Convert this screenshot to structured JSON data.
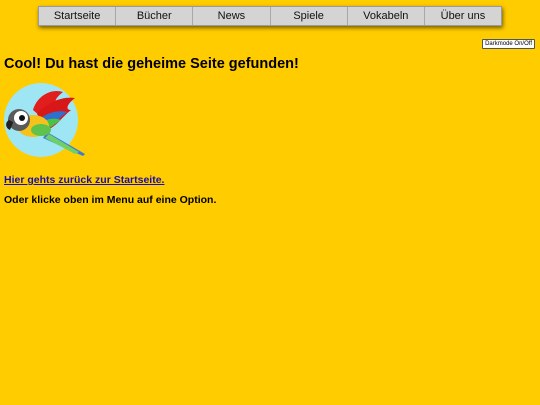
{
  "nav": {
    "items": [
      {
        "label": "Startseite"
      },
      {
        "label": "Bücher"
      },
      {
        "label": "News"
      },
      {
        "label": "Spiele"
      },
      {
        "label": "Vokabeln"
      },
      {
        "label": "Über uns"
      }
    ]
  },
  "darkmode_button": {
    "label": "Darkmode On/Off"
  },
  "main": {
    "headline": "Cool! Du hast die geheime Seite gefunden!",
    "back_link": "Hier gehts zurück zur Startseite.",
    "hint": "Oder klicke oben im Menu auf eine Option."
  },
  "colors": {
    "background": "#ffcc00",
    "nav_background": "#d4d4d4",
    "link": "#1a0dab",
    "parrot_circle": "#9fe6f5"
  },
  "image": {
    "icon": "parrot-icon"
  }
}
